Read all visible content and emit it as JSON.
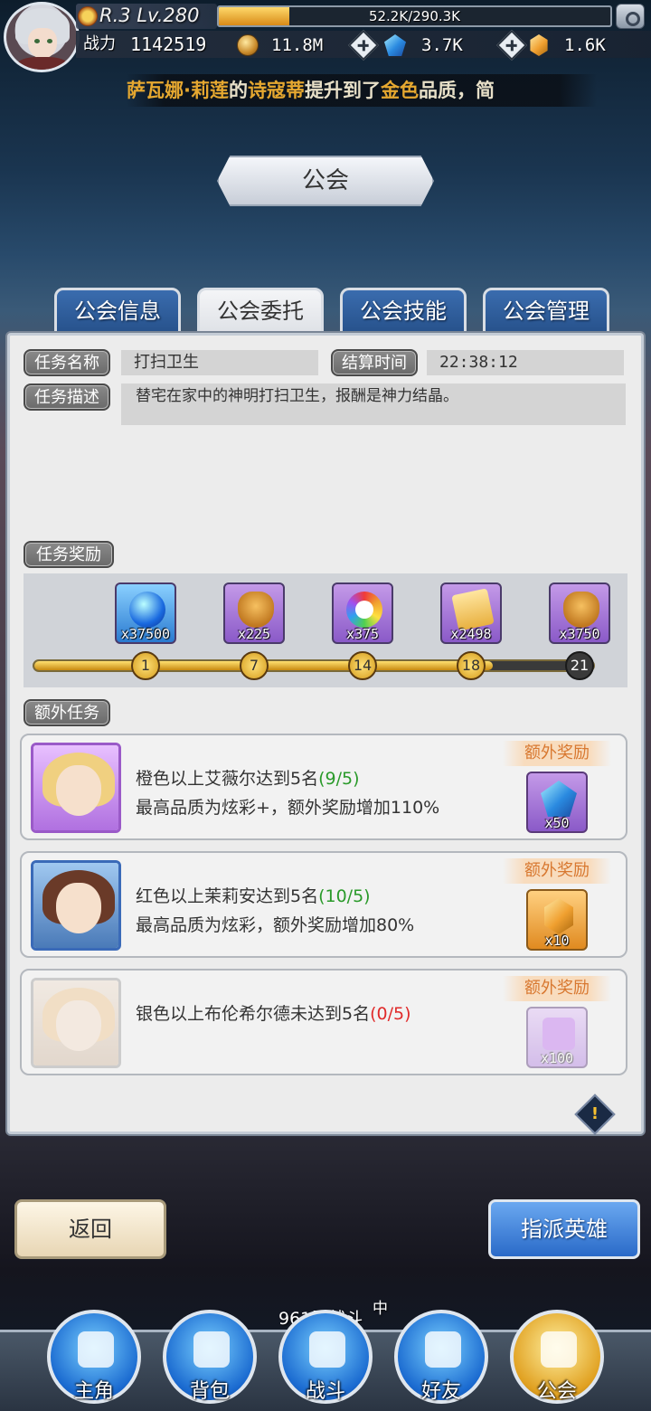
{
  "header": {
    "rank": "R.3 Lv.280",
    "exp_text": "52.2K/290.3K",
    "exp_fraction": 0.18,
    "power_label": "战力",
    "power_value": "1142519",
    "resources": [
      {
        "icon": "gold-coin-icon",
        "value": "11.8M"
      },
      {
        "icon": "blue-gem-icon",
        "value": "3.7K"
      },
      {
        "icon": "gold-crystal-icon",
        "value": "1.6K"
      }
    ]
  },
  "marquee": {
    "parts": [
      {
        "text": "萨瓦娜·莉莲",
        "style": "gold"
      },
      {
        "text": "的",
        "style": "w"
      },
      {
        "text": "诗寇蒂",
        "style": "gold"
      },
      {
        "text": "提升到了",
        "style": "w"
      },
      {
        "text": "金色",
        "style": "gold"
      },
      {
        "text": "品质，简",
        "style": "w"
      }
    ]
  },
  "page_title": "公会",
  "tabs": [
    {
      "label": "公会信息",
      "active": false
    },
    {
      "label": "公会委托",
      "active": true
    },
    {
      "label": "公会技能",
      "active": false
    },
    {
      "label": "公会管理",
      "active": false
    }
  ],
  "task": {
    "name_label": "任务名称",
    "name_value": "打扫卫生",
    "time_label": "结算时间",
    "time_value": "22:38:12",
    "desc_label": "任务描述",
    "desc_value": "替宅在家中的神明打扫卫生，报酬是神力结晶。",
    "reward_label": "任务奖励",
    "rewards": [
      {
        "icon": "blue-potion-icon",
        "qty": "x37500"
      },
      {
        "icon": "gem-bag-icon",
        "qty": "x225"
      },
      {
        "icon": "rainbow-medal-icon",
        "qty": "x375"
      },
      {
        "icon": "scroll-icon",
        "qty": "x2498"
      },
      {
        "icon": "gold-bag-icon",
        "qty": "x3750"
      }
    ],
    "milestones": [
      "1",
      "7",
      "14",
      "18",
      "21"
    ],
    "progress_fraction": 0.82
  },
  "extra": {
    "label": "额外任务",
    "reward_label": "额外奖励",
    "tasks": [
      {
        "line1": "橙色以上艾薇尔达到5名",
        "count": "(9/5)",
        "count_color": "green",
        "line2": "最高品质为炫彩+，额外奖励增加110%",
        "reward_icon": "blue-gem-icon",
        "reward_qty": "x50",
        "dim": false
      },
      {
        "line1": "红色以上茉莉安达到5名",
        "count": "(10/5)",
        "count_color": "green",
        "line2": "最高品质为炫彩，额外奖励增加80%",
        "reward_icon": "gold-crystal-icon",
        "reward_qty": "x10",
        "dim": false
      },
      {
        "line1": "银色以上布伦希尔德未达到5名",
        "count": "(0/5)",
        "count_color": "red",
        "line2": "",
        "reward_icon": "puzzle-piece-icon",
        "reward_qty": "x100",
        "dim": true
      }
    ]
  },
  "buttons": {
    "back": "返回",
    "assign": "指派英雄"
  },
  "nav": {
    "battle_status": "961层战斗",
    "battle_sup": "中",
    "items": [
      {
        "label": "主角",
        "icon": "hero-icon"
      },
      {
        "label": "背包",
        "icon": "backpack-icon"
      },
      {
        "label": "战斗",
        "icon": "crossed-swords-icon"
      },
      {
        "label": "好友",
        "icon": "handshake-icon"
      },
      {
        "label": "公会",
        "icon": "guild-crest-icon"
      }
    ]
  },
  "colors": {
    "accent_gold": "#e6a830",
    "tab_blue": "#2f5f9e",
    "green": "#2a9a2a",
    "red": "#e02a2a"
  }
}
